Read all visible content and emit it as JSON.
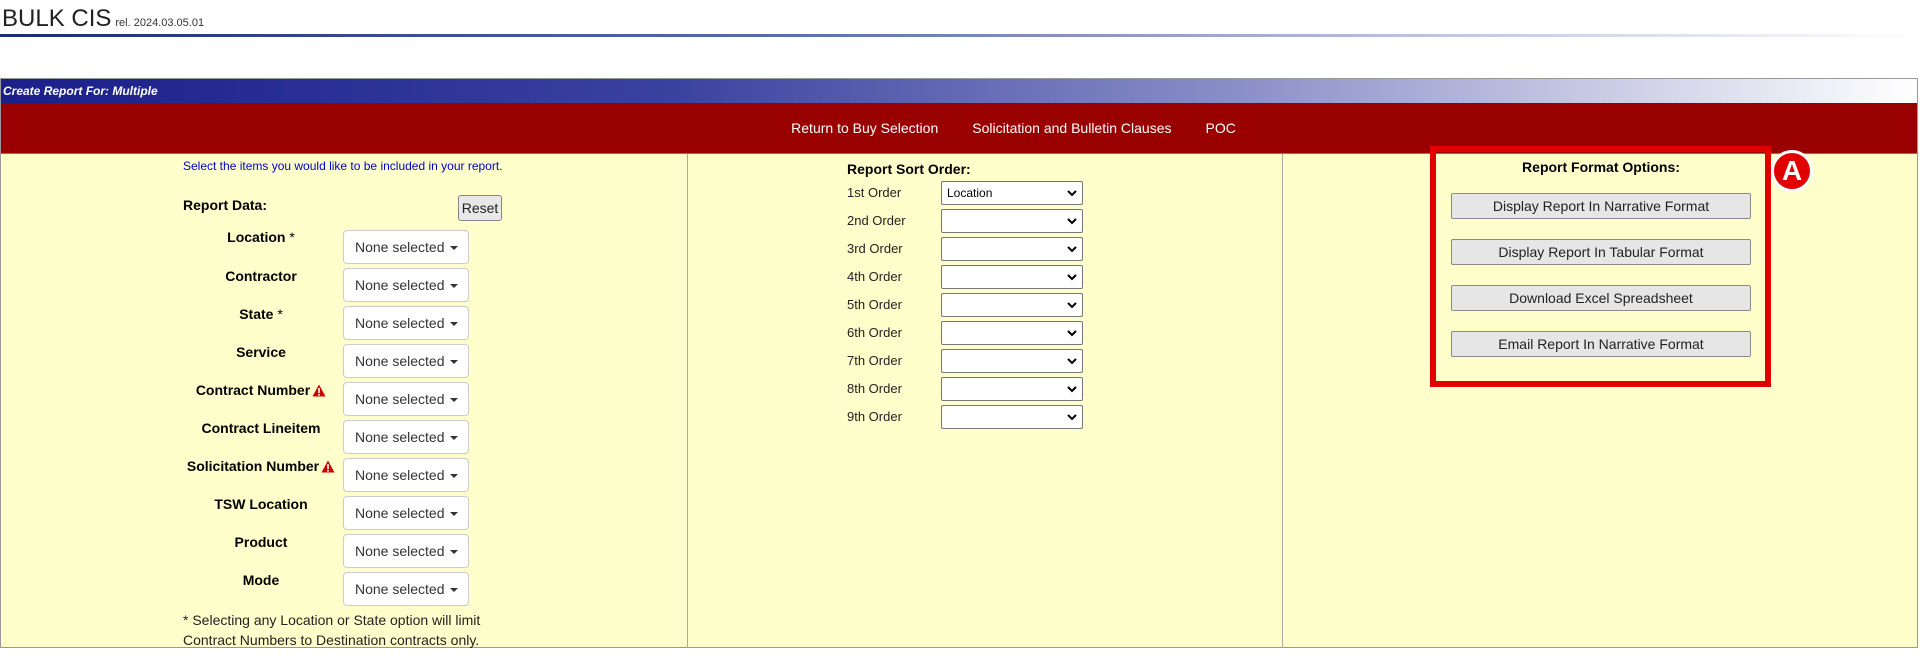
{
  "app": {
    "title": "BULK CIS",
    "release": "rel. 2024.03.05.01"
  },
  "panel": {
    "title": "Create Report For: Multiple"
  },
  "nav": [
    {
      "label": "Return to Buy Selection"
    },
    {
      "label": "Solicitation and Bulletin Clauses"
    },
    {
      "label": "POC"
    }
  ],
  "report_data": {
    "instructions": "Select the items you would like to be included in your report.",
    "label": "Report Data:",
    "reset_label": "Reset",
    "fields": [
      {
        "label": "Location",
        "required": "*",
        "value": "None selected"
      },
      {
        "label": "Contractor",
        "required": "",
        "value": "None selected"
      },
      {
        "label": "State",
        "required": "*",
        "value": "None selected"
      },
      {
        "label": "Service",
        "required": "",
        "value": "None selected"
      },
      {
        "label": "Contract Number",
        "required": "",
        "value": "None selected"
      },
      {
        "label": "Contract Lineitem",
        "required": "",
        "value": "None selected"
      },
      {
        "label": "Solicitation Number",
        "required": "",
        "value": "None selected"
      },
      {
        "label": "TSW Location",
        "required": "",
        "value": "None selected"
      },
      {
        "label": "Product",
        "required": "",
        "value": "None selected"
      },
      {
        "label": "Mode",
        "required": "",
        "value": "None selected"
      }
    ],
    "footnote_line1": "* Selecting any Location or State option will limit",
    "footnote_line2": "Contract Numbers to Destination contracts only."
  },
  "sort_order": {
    "title": "Report Sort Order:",
    "orders": [
      {
        "label": "1st Order",
        "value": "Location"
      },
      {
        "label": "2nd Order",
        "value": ""
      },
      {
        "label": "3rd Order",
        "value": ""
      },
      {
        "label": "4th Order",
        "value": ""
      },
      {
        "label": "5th Order",
        "value": ""
      },
      {
        "label": "6th Order",
        "value": ""
      },
      {
        "label": "7th Order",
        "value": ""
      },
      {
        "label": "8th Order",
        "value": ""
      },
      {
        "label": "9th Order",
        "value": ""
      }
    ]
  },
  "format_options": {
    "title": "Report Format Options:",
    "buttons": [
      {
        "label": "Display Report In Narrative Format"
      },
      {
        "label": "Display Report In Tabular Format"
      },
      {
        "label": "Download Excel Spreadsheet"
      },
      {
        "label": "Email Report In Narrative Format"
      }
    ]
  },
  "annotation": {
    "label": "A",
    "color": "#e00000"
  },
  "colors": {
    "nav_bar": "#990000",
    "panel_bg": "#ffffcc",
    "title_bar": "#1a1f8a",
    "link_blue": "#0000cc"
  }
}
